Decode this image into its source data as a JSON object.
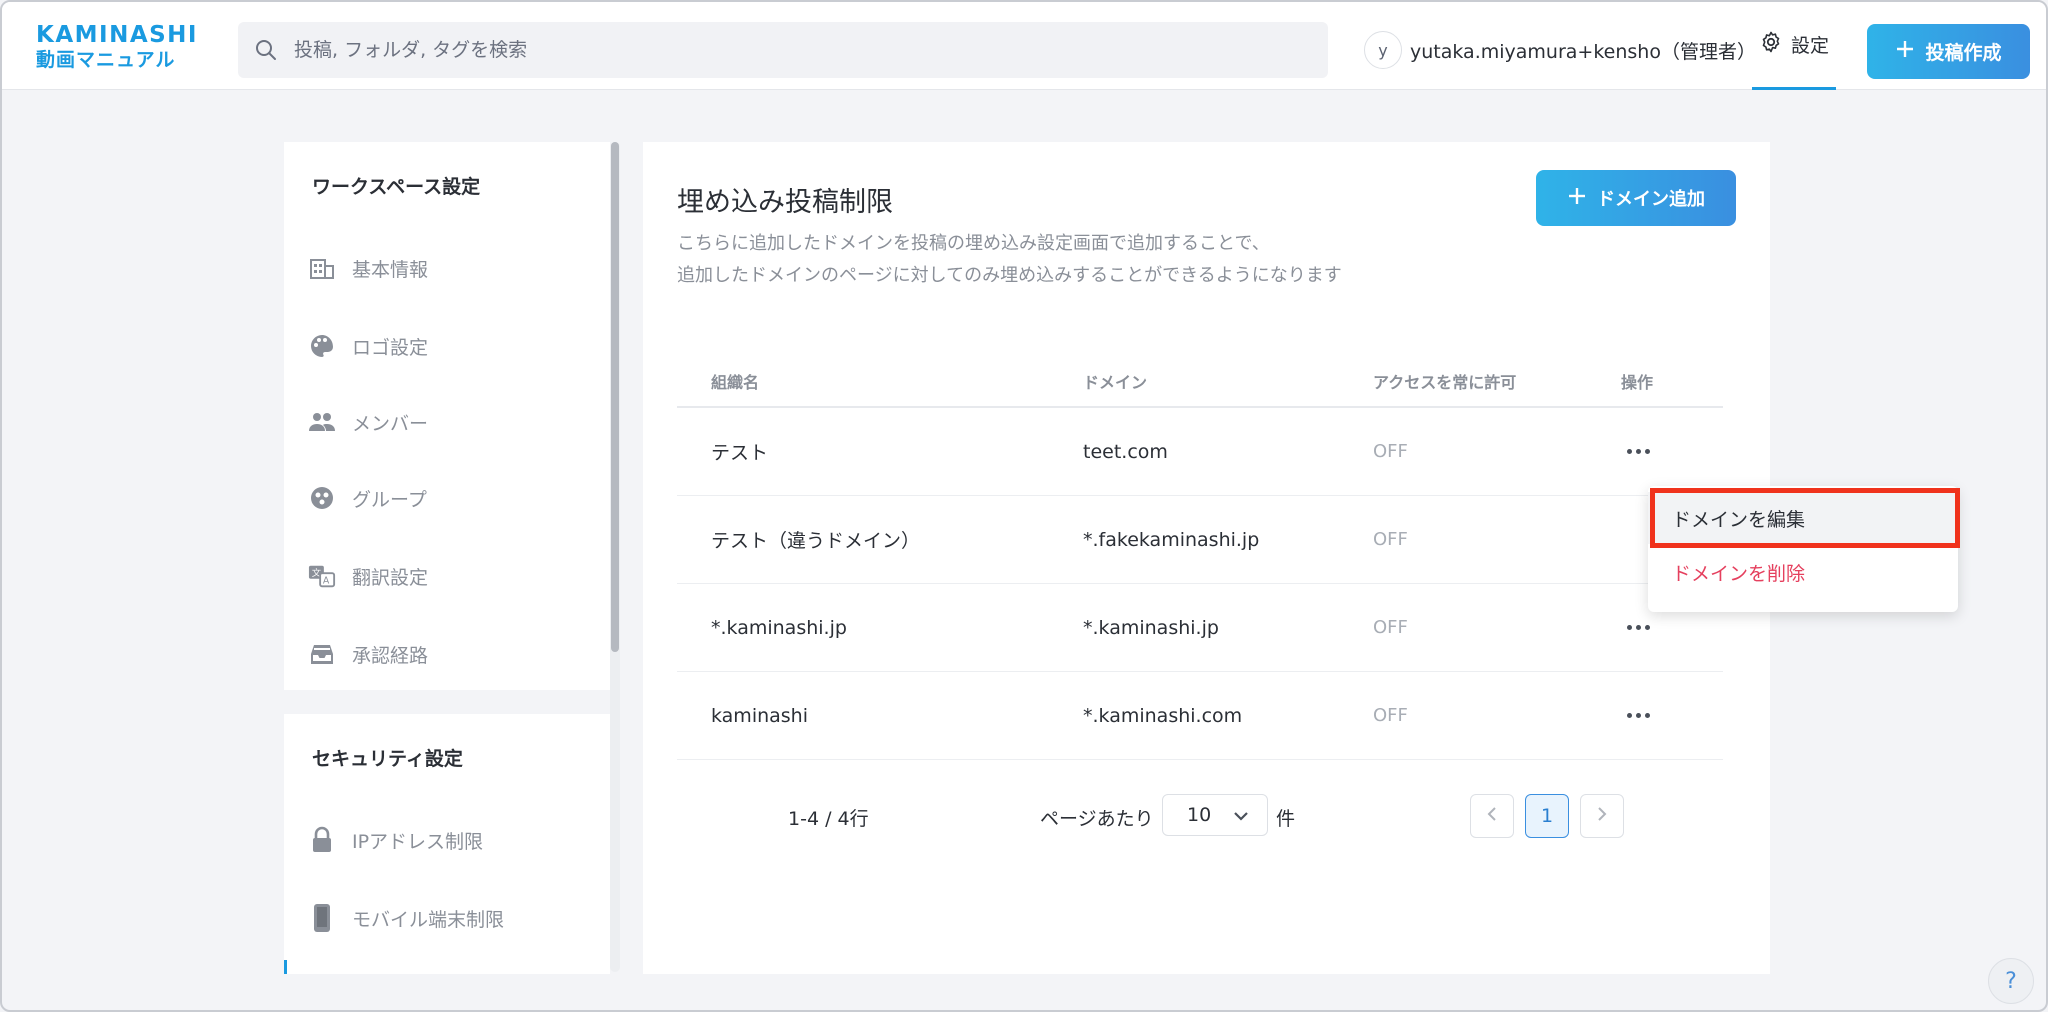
{
  "header": {
    "logo_top": "KAMINASHI",
    "logo_bottom": "動画マニュアル",
    "search_placeholder": "投稿, フォルダ, タグを検索",
    "user_initial": "y",
    "user_name": "yutaka.miyamura+kensho（管理者）",
    "settings_label": "設定",
    "create_label": "投稿作成",
    "accent_color": "#1a9ae0"
  },
  "sidebar": {
    "workspace_title": "ワークスペース設定",
    "items": [
      {
        "label": "基本情報",
        "icon": "building-icon"
      },
      {
        "label": "ロゴ設定",
        "icon": "palette-icon"
      },
      {
        "label": "メンバー",
        "icon": "members-icon"
      },
      {
        "label": "グループ",
        "icon": "group-icon"
      },
      {
        "label": "翻訳設定",
        "icon": "translate-icon"
      },
      {
        "label": "承認経路",
        "icon": "inbox-icon"
      }
    ],
    "security_title": "セキュリティ設定",
    "security_items": [
      {
        "label": "IPアドレス制限",
        "icon": "lock-icon"
      },
      {
        "label": "モバイル端末制限",
        "icon": "mobile-icon"
      }
    ]
  },
  "main": {
    "title": "埋め込み投稿制限",
    "desc_line1": "こちらに追加したドメインを投稿の埋め込み設定画面で追加することで、",
    "desc_line2": "追加したドメインのページに対してのみ埋め込みすることができるようになります",
    "add_button": "ドメイン追加",
    "columns": [
      "組織名",
      "ドメイン",
      "アクセスを常に許可",
      "操作"
    ],
    "rows": [
      {
        "org": "テスト",
        "domain": "teet.com",
        "access": "OFF"
      },
      {
        "org": "テスト（違うドメイン）",
        "domain": "*.fakekaminashi.jp",
        "access": "OFF"
      },
      {
        "org": "*.kaminashi.jp",
        "domain": "*.kaminashi.jp",
        "access": "OFF"
      },
      {
        "org": "kaminashi",
        "domain": "*.kaminashi.com",
        "access": "OFF"
      }
    ],
    "pagination": {
      "range": "1-4 / 4行",
      "per_page_label": "ページあたり",
      "per_page_value": "10",
      "unit": "件",
      "current_page": "1"
    }
  },
  "menu": {
    "edit": "ドメインを編集",
    "delete": "ドメインを削除"
  },
  "help": "?"
}
